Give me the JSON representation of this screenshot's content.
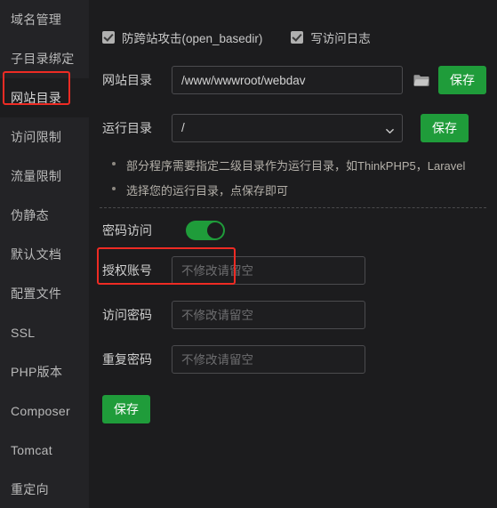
{
  "sidebar": {
    "items": [
      {
        "label": "域名管理",
        "active": false
      },
      {
        "label": "子目录绑定",
        "active": false
      },
      {
        "label": "网站目录",
        "active": true
      },
      {
        "label": "访问限制",
        "active": false
      },
      {
        "label": "流量限制",
        "active": false
      },
      {
        "label": "伪静态",
        "active": false
      },
      {
        "label": "默认文档",
        "active": false
      },
      {
        "label": "配置文件",
        "active": false
      },
      {
        "label": "SSL",
        "active": false
      },
      {
        "label": "PHP版本",
        "active": false
      },
      {
        "label": "Composer",
        "active": false
      },
      {
        "label": "Tomcat",
        "active": false
      },
      {
        "label": "重定向",
        "active": false
      }
    ]
  },
  "options": {
    "anti_cross_site": {
      "label": "防跨站攻击(open_basedir)",
      "checked": true
    },
    "write_access_log": {
      "label": "写访问日志",
      "checked": true
    }
  },
  "site_dir": {
    "label": "网站目录",
    "value": "/www/wwwroot/webdav",
    "placeholder": "",
    "folder_icon": "folder-icon",
    "save_label": "保存"
  },
  "run_dir": {
    "label": "运行目录",
    "value": "/",
    "chevron_icon": "chevron-down-icon",
    "options": [
      "/"
    ],
    "save_label": "保存"
  },
  "tips": [
    "部分程序需要指定二级目录作为运行目录，如ThinkPHP5，Laravel",
    "选择您的运行目录，点保存即可"
  ],
  "password_access": {
    "label": "密码访问",
    "enabled": true
  },
  "credentials": [
    {
      "label": "授权账号",
      "value": "",
      "placeholder": "不修改请留空"
    },
    {
      "label": "访问密码",
      "value": "",
      "placeholder": "不修改请留空"
    },
    {
      "label": "重复密码",
      "value": "",
      "placeholder": "不修改请留空"
    }
  ],
  "bottom_save_label": "保存",
  "colors": {
    "accent_green": "#1f9c3a",
    "annotation_red": "#ee2b24",
    "sidebar_bg": "#232326",
    "content_bg": "#1c1c1e"
  }
}
